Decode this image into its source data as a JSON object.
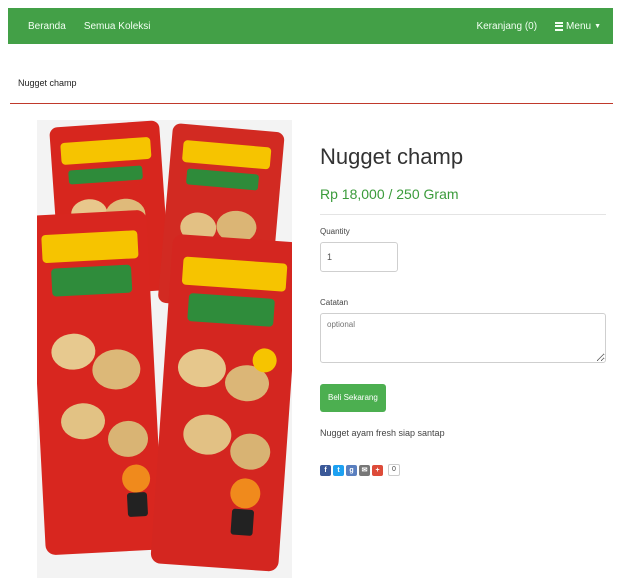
{
  "navbar": {
    "links": [
      "Beranda",
      "Semua Koleksi"
    ],
    "cart_label": "Keranjang (0)",
    "menu_label": "Menu",
    "color": "#43a047"
  },
  "breadcrumb": {
    "current": "Nugget champ"
  },
  "product": {
    "title": "Nugget champ",
    "price": "Rp 18,000 / 250 Gram",
    "quantity_label": "Quantity",
    "quantity_value": "1",
    "notes_label": "Catatan",
    "notes_placeholder": "optional",
    "buy_label": "Beli Sekarang",
    "description": "Nugget ayam fresh siap santap",
    "image_icon": "product-photo"
  },
  "share": {
    "icons": [
      "facebook-icon",
      "twitter-icon",
      "google-icon",
      "email-icon",
      "plus-icon"
    ],
    "colors": [
      "#3b5998",
      "#1da1f2",
      "#5a7fbf",
      "#777777",
      "#dd4b39"
    ],
    "count": "0"
  }
}
